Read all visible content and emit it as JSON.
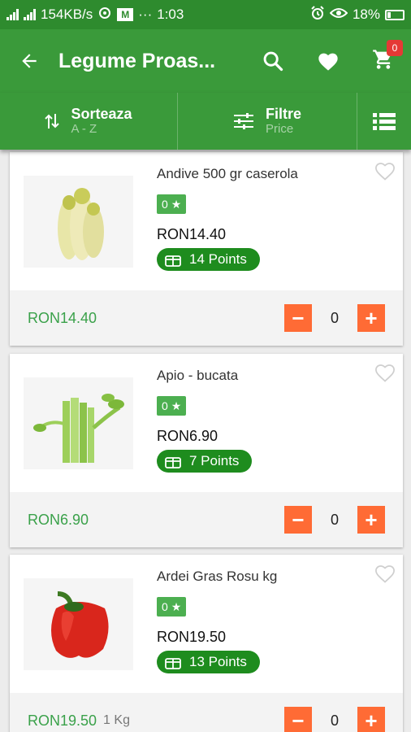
{
  "status_bar": {
    "net_speed": "154KB/s",
    "time": "1:03",
    "battery": "18%"
  },
  "app_bar": {
    "title": "Legume Proas...",
    "cart_count": "0"
  },
  "sort_bar": {
    "sort_label": "Sorteaza",
    "sort_value": "A - Z",
    "filter_label": "Filtre",
    "filter_value": "Price"
  },
  "products": [
    {
      "name": "Andive 500 gr caserola",
      "rating": "0",
      "price": "RON14.40",
      "points": "14 Points",
      "bottom_price": "RON14.40",
      "unit": "",
      "qty": "0"
    },
    {
      "name": "Apio - bucata",
      "rating": "0",
      "price": "RON6.90",
      "points": "7 Points",
      "bottom_price": "RON6.90",
      "unit": "",
      "qty": "0"
    },
    {
      "name": "Ardei Gras Rosu kg",
      "rating": "0",
      "price": "RON19.50",
      "points": "13 Points",
      "bottom_price": "RON19.50",
      "unit": "1 Kg",
      "qty": "0"
    }
  ],
  "colors": {
    "app_bar": "#3a9a3a",
    "status_bar": "#2e8b2e",
    "qty_button": "#ff6b35",
    "points_pill": "#1e8c1e",
    "price_text": "#3aa14a"
  },
  "icons": {
    "back": "arrow-left-icon",
    "search": "search-icon",
    "favorites": "heart-icon",
    "cart": "cart-icon",
    "sort": "sort-arrows-icon",
    "filter": "sliders-icon",
    "view": "list-view-icon"
  }
}
